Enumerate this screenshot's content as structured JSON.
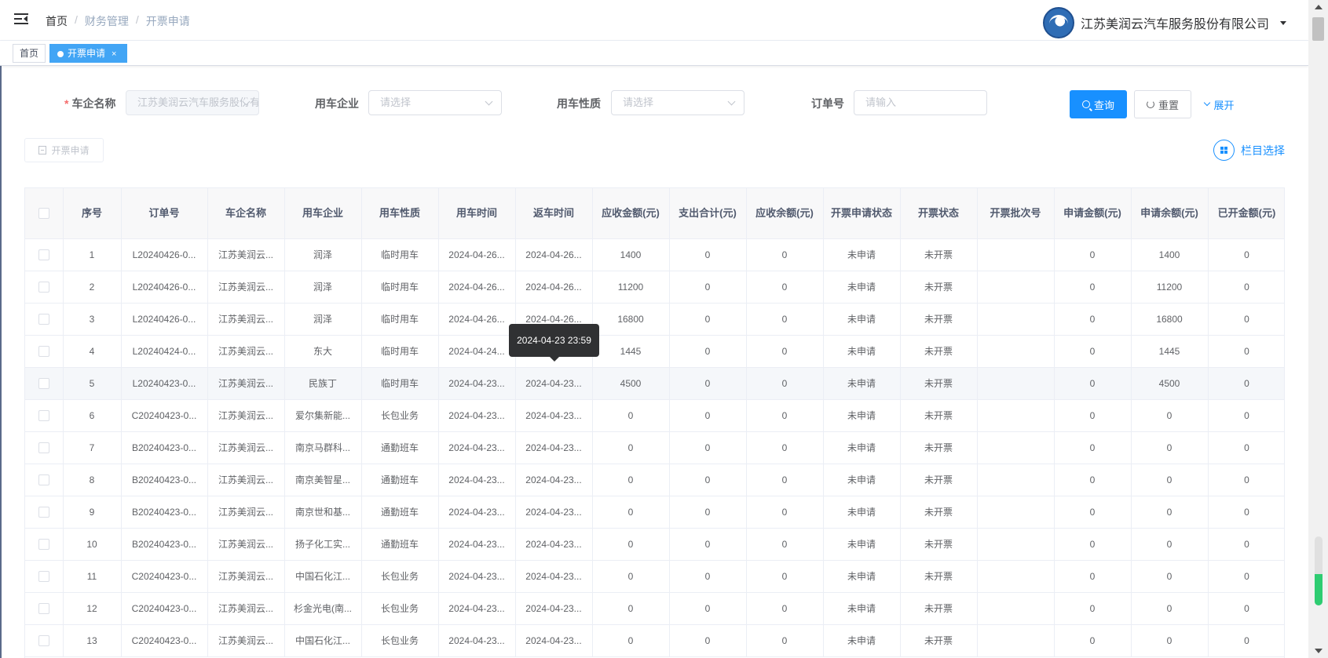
{
  "breadcrumb": {
    "home": "首页",
    "sep": "/",
    "section": "财务管理",
    "current": "开票申请"
  },
  "company": {
    "name": "江苏美润云汽车服务股份有限公司"
  },
  "tags": {
    "home": "首页",
    "active": "开票申请",
    "close": "×"
  },
  "filters": {
    "company_label": "车企名称",
    "company_value": "江苏美润云汽车服务股份有限公司",
    "enterprise_label": "用车企业",
    "enterprise_placeholder": "请选择",
    "nature_label": "用车性质",
    "nature_placeholder": "请选择",
    "order_label": "订单号",
    "order_placeholder": "请输入"
  },
  "buttons": {
    "query": "查询",
    "reset": "重置",
    "expand": "展开",
    "apply": "开票申请",
    "columns": "栏目选择"
  },
  "table": {
    "headers": [
      "序号",
      "订单号",
      "车企名称",
      "用车企业",
      "用车性质",
      "用车时间",
      "返车时间",
      "应收金额(元)",
      "支出合计(元)",
      "应收余额(元)",
      "开票申请状态",
      "开票状态",
      "开票批次号",
      "申请金额(元)",
      "申请余额(元)",
      "已开金额(元)"
    ],
    "rows": [
      [
        "1",
        "L20240426-0...",
        "江苏美润云...",
        "润泽",
        "临时用车",
        "2024-04-26...",
        "2024-04-26...",
        "1400",
        "0",
        "0",
        "未申请",
        "未开票",
        "",
        "0",
        "1400",
        "0"
      ],
      [
        "2",
        "L20240426-0...",
        "江苏美润云...",
        "润泽",
        "临时用车",
        "2024-04-26...",
        "2024-04-26...",
        "11200",
        "0",
        "0",
        "未申请",
        "未开票",
        "",
        "0",
        "11200",
        "0"
      ],
      [
        "3",
        "L20240426-0...",
        "江苏美润云...",
        "润泽",
        "临时用车",
        "2024-04-26...",
        "2024-04-26...",
        "16800",
        "0",
        "0",
        "未申请",
        "未开票",
        "",
        "0",
        "16800",
        "0"
      ],
      [
        "4",
        "L20240424-0...",
        "江苏美润云...",
        "东大",
        "临时用车",
        "2024-04-24...",
        "",
        "1445",
        "0",
        "0",
        "未申请",
        "未开票",
        "",
        "0",
        "1445",
        "0"
      ],
      [
        "5",
        "L20240423-0...",
        "江苏美润云...",
        "民族丁",
        "临时用车",
        "2024-04-23...",
        "2024-04-23...",
        "4500",
        "0",
        "0",
        "未申请",
        "未开票",
        "",
        "0",
        "4500",
        "0"
      ],
      [
        "6",
        "C20240423-0...",
        "江苏美润云...",
        "爱尔集新能...",
        "长包业务",
        "2024-04-23...",
        "2024-04-23...",
        "0",
        "0",
        "0",
        "未申请",
        "未开票",
        "",
        "0",
        "0",
        "0"
      ],
      [
        "7",
        "B20240423-0...",
        "江苏美润云...",
        "南京马群科...",
        "通勤班车",
        "2024-04-23...",
        "2024-04-23...",
        "0",
        "0",
        "0",
        "未申请",
        "未开票",
        "",
        "0",
        "0",
        "0"
      ],
      [
        "8",
        "B20240423-0...",
        "江苏美润云...",
        "南京美智星...",
        "通勤班车",
        "2024-04-23...",
        "2024-04-23...",
        "0",
        "0",
        "0",
        "未申请",
        "未开票",
        "",
        "0",
        "0",
        "0"
      ],
      [
        "9",
        "B20240423-0...",
        "江苏美润云...",
        "南京世和基...",
        "通勤班车",
        "2024-04-23...",
        "2024-04-23...",
        "0",
        "0",
        "0",
        "未申请",
        "未开票",
        "",
        "0",
        "0",
        "0"
      ],
      [
        "10",
        "B20240423-0...",
        "江苏美润云...",
        "扬子化工实...",
        "通勤班车",
        "2024-04-23...",
        "2024-04-23...",
        "0",
        "0",
        "0",
        "未申请",
        "未开票",
        "",
        "0",
        "0",
        "0"
      ],
      [
        "11",
        "C20240423-0...",
        "江苏美润云...",
        "中国石化江...",
        "长包业务",
        "2024-04-23...",
        "2024-04-23...",
        "0",
        "0",
        "0",
        "未申请",
        "未开票",
        "",
        "0",
        "0",
        "0"
      ],
      [
        "12",
        "C20240423-0...",
        "江苏美润云...",
        "杉金光电(南...",
        "长包业务",
        "2024-04-23...",
        "2024-04-23...",
        "0",
        "0",
        "0",
        "未申请",
        "未开票",
        "",
        "0",
        "0",
        "0"
      ],
      [
        "13",
        "C20240423-0...",
        "江苏美润云...",
        "中国石化江...",
        "长包业务",
        "2024-04-23...",
        "2024-04-23...",
        "0",
        "0",
        "0",
        "未申请",
        "未开票",
        "",
        "0",
        "0",
        "0"
      ]
    ]
  },
  "tooltip": {
    "text": "2024-04-23 23:59"
  },
  "icons": [
    "hamburger-icon",
    "company-logo",
    "chevron-down-icon",
    "search-icon",
    "refresh-icon",
    "document-icon",
    "grid-icon"
  ],
  "colors": {
    "primary": "#1890ff",
    "tag_active": "#42a5f5",
    "required": "#f56c6c",
    "tooltip_bg": "#303133",
    "scroll_fill": "#2ecc71"
  },
  "inner_scroll_fill_fraction": 0.45
}
